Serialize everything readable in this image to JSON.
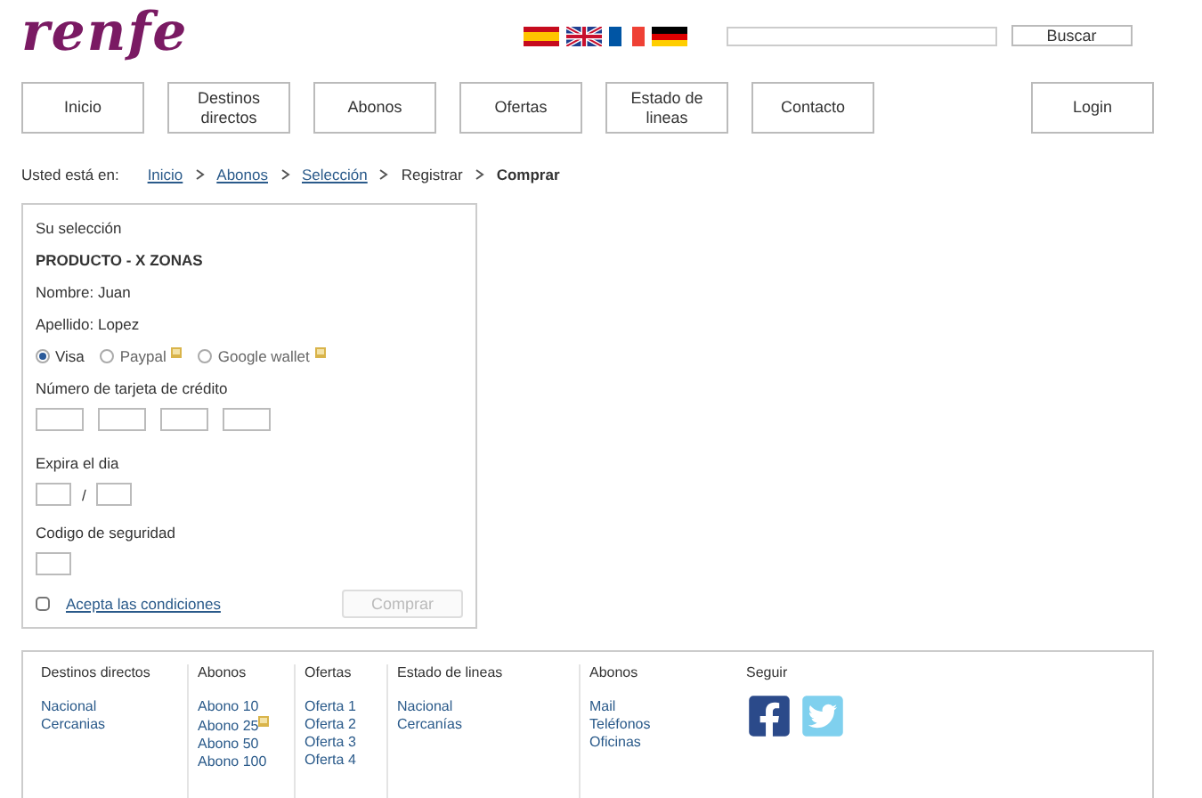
{
  "logo": "renfe",
  "search": {
    "button": "Buscar"
  },
  "nav": [
    {
      "label": "Inicio"
    },
    {
      "label": "Destinos\ndirectos"
    },
    {
      "label": "Abonos"
    },
    {
      "label": "Ofertas"
    },
    {
      "label": "Estado de\nlineas"
    },
    {
      "label": "Contacto"
    }
  ],
  "login": "Login",
  "breadcrumb": {
    "prefix": "Usted está  en:",
    "items": [
      {
        "label": "Inicio",
        "kind": "link"
      },
      {
        "label": "Abonos",
        "kind": "link"
      },
      {
        "label": "Selección",
        "kind": "link"
      },
      {
        "label": "Registrar",
        "kind": "text"
      },
      {
        "label": "Comprar",
        "kind": "current"
      }
    ]
  },
  "panel": {
    "title": "Su selección",
    "product": "PRODUCTO - X ZONAS",
    "name": "Nombre: Juan",
    "surname": "Apellido: Lopez",
    "payment": [
      {
        "label": "Visa",
        "selected": true,
        "broken_image": false
      },
      {
        "label": "Paypal",
        "selected": false,
        "broken_image": true
      },
      {
        "label": "Google wallet",
        "selected": false,
        "broken_image": true
      }
    ],
    "card_label": "Número de tarjeta de crédito",
    "expiry_label": "Expira el dia",
    "expiry_separator": "/",
    "security_label": "Codigo de seguridad",
    "terms": {
      "label": "Acepta las condiciones",
      "checked": false
    },
    "buy_button": {
      "label": "Comprar",
      "disabled": true
    }
  },
  "footer": {
    "columns": [
      {
        "heading": "Destinos directos",
        "links": [
          {
            "label": "Nacional",
            "broken_image": false
          },
          {
            "label": "Cercanias",
            "broken_image": false
          }
        ]
      },
      {
        "heading": "Abonos",
        "links": [
          {
            "label": "Abono 10",
            "broken_image": false
          },
          {
            "label": "Abono 25",
            "broken_image": true
          },
          {
            "label": "Abono 50",
            "broken_image": false
          },
          {
            "label": "Abono 100",
            "broken_image": false
          }
        ]
      },
      {
        "heading": "Ofertas",
        "links": [
          {
            "label": "Oferta 1",
            "broken_image": false
          },
          {
            "label": "Oferta 2",
            "broken_image": false
          },
          {
            "label": "Oferta 3",
            "broken_image": false
          },
          {
            "label": "Oferta 4",
            "broken_image": false
          }
        ]
      },
      {
        "heading": "Estado de lineas",
        "links": [
          {
            "label": "Nacional",
            "broken_image": false
          },
          {
            "label": "Cercanías",
            "broken_image": false
          }
        ]
      },
      {
        "heading": "Abonos",
        "links": [
          {
            "label": "Mail",
            "broken_image": false
          },
          {
            "label": "Teléfonos",
            "broken_image": false
          },
          {
            "label": "Oficinas",
            "broken_image": false
          }
        ]
      }
    ],
    "follow": {
      "heading": "Seguir"
    }
  }
}
